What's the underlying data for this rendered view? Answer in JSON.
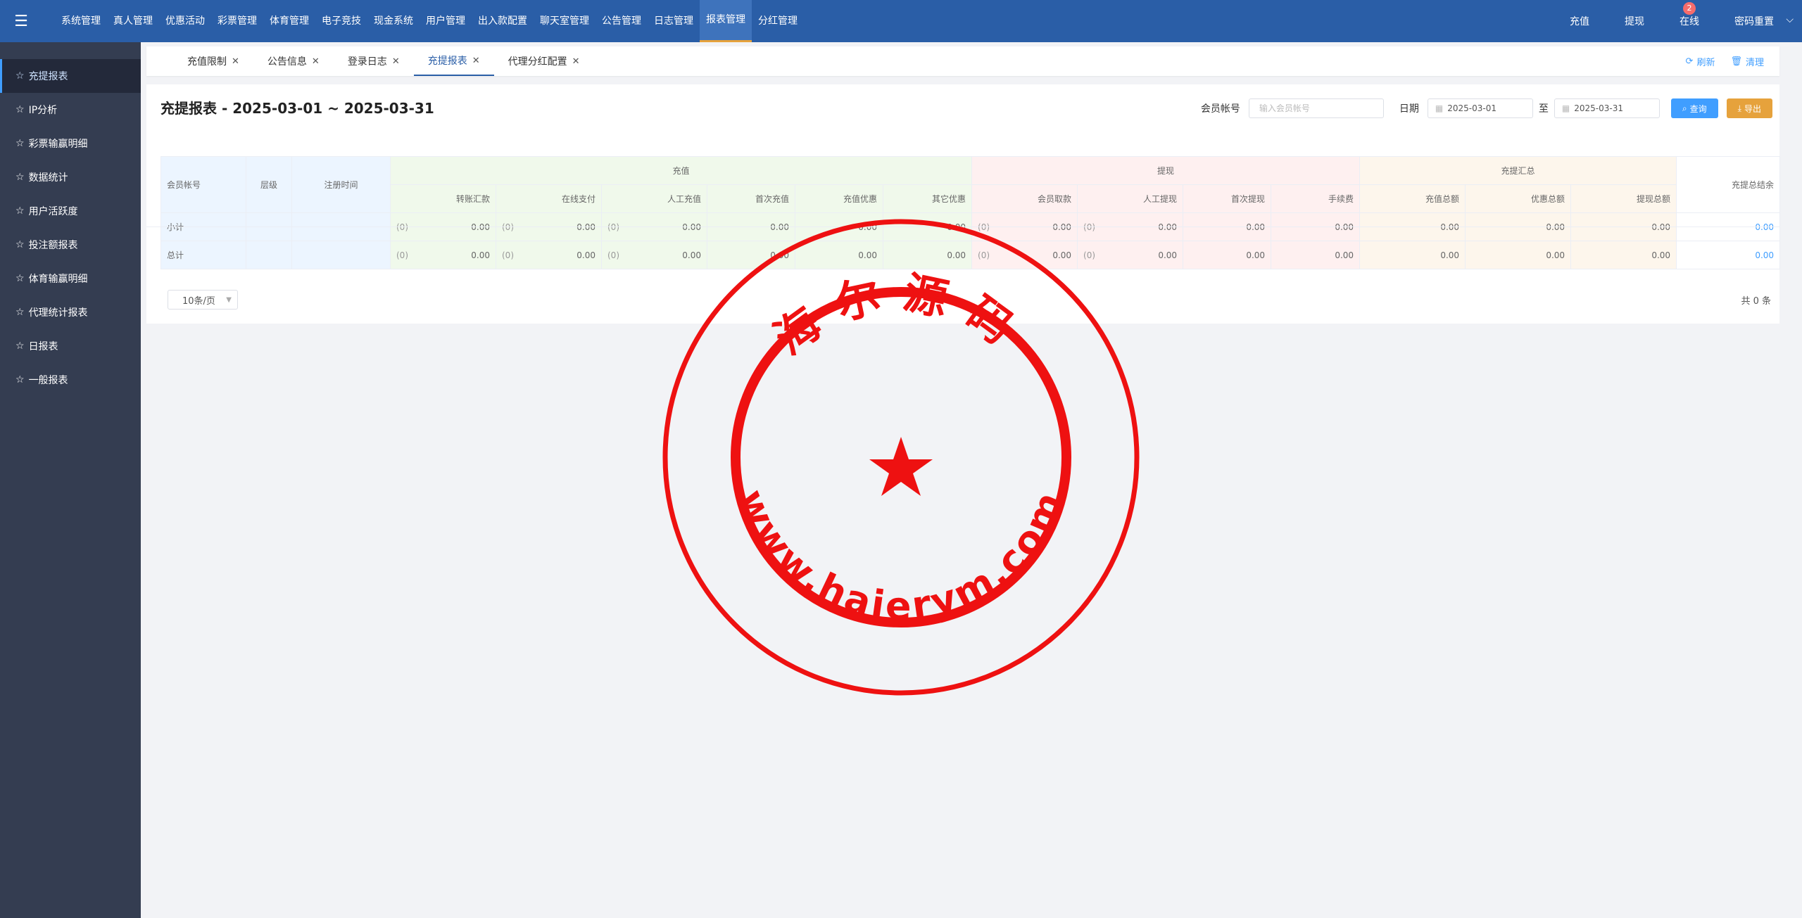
{
  "topnav": {
    "items": [
      "系统管理",
      "真人管理",
      "优惠活动",
      "彩票管理",
      "体育管理",
      "电子竞技",
      "现金系统",
      "用户管理",
      "出入款配置",
      "聊天室管理",
      "公告管理",
      "日志管理",
      "报表管理",
      "分红管理"
    ],
    "active_index": 12,
    "right": {
      "deposit": "充值",
      "withdraw": "提现",
      "online": "在线",
      "online_badge": "2",
      "password_reset": "密码重置"
    }
  },
  "sidebar": {
    "items": [
      "充提报表",
      "IP分析",
      "彩票输赢明细",
      "数据统计",
      "用户活跃度",
      "投注额报表",
      "体育输赢明细",
      "代理统计报表",
      "日报表",
      "一般报表"
    ],
    "active_index": 0
  },
  "tabs": {
    "items": [
      "充值限制",
      "公告信息",
      "登录日志",
      "充提报表",
      "代理分红配置"
    ],
    "active_index": 3,
    "refresh": "刷新",
    "clear": "清理"
  },
  "page": {
    "title": "充提报表 - 2025-03-01 ~ 2025-03-31"
  },
  "filters": {
    "member_label": "会员帐号",
    "member_placeholder": "输入会员帐号",
    "date_label": "日期",
    "date_from": "2025-03-01",
    "to_label": "至",
    "date_to": "2025-03-31",
    "search_label": "查询",
    "export_label": "导出"
  },
  "table": {
    "fixed_headers": [
      "会员帐号",
      "层级",
      "注册时间"
    ],
    "groups": {
      "deposit": "充值",
      "withdraw": "提现",
      "summary": "充提汇总",
      "net": "充提总结余"
    },
    "deposit_cols": [
      "转账汇款",
      "在线支付",
      "人工充值",
      "首次充值",
      "充值优惠",
      "其它优惠"
    ],
    "withdraw_cols": [
      "会员取款",
      "人工提现",
      "首次提现",
      "手续费"
    ],
    "summary_cols": [
      "充值总额",
      "优惠总额",
      "提现总额"
    ],
    "rows": [
      {
        "label": "小计",
        "deposit": [
          {
            "cnt": "(0)",
            "v": "0.00"
          },
          {
            "cnt": "(0)",
            "v": "0.00"
          },
          {
            "cnt": "(0)",
            "v": "0.00"
          },
          {
            "cnt": "",
            "v": "0.00"
          },
          {
            "cnt": "",
            "v": "0.00"
          },
          {
            "cnt": "",
            "v": "0.00"
          }
        ],
        "withdraw": [
          {
            "cnt": "(0)",
            "v": "0.00"
          },
          {
            "cnt": "(0)",
            "v": "0.00"
          },
          {
            "cnt": "",
            "v": "0.00"
          },
          {
            "cnt": "",
            "v": "0.00"
          }
        ],
        "summary": [
          "0.00",
          "0.00",
          "0.00"
        ],
        "net": "0.00"
      },
      {
        "label": "总计",
        "deposit": [
          {
            "cnt": "(0)",
            "v": "0.00"
          },
          {
            "cnt": "(0)",
            "v": "0.00"
          },
          {
            "cnt": "(0)",
            "v": "0.00"
          },
          {
            "cnt": "",
            "v": "0.00"
          },
          {
            "cnt": "",
            "v": "0.00"
          },
          {
            "cnt": "",
            "v": "0.00"
          }
        ],
        "withdraw": [
          {
            "cnt": "(0)",
            "v": "0.00"
          },
          {
            "cnt": "(0)",
            "v": "0.00"
          },
          {
            "cnt": "",
            "v": "0.00"
          },
          {
            "cnt": "",
            "v": "0.00"
          }
        ],
        "summary": [
          "0.00",
          "0.00",
          "0.00"
        ],
        "net": "0.00"
      }
    ]
  },
  "pager": {
    "page_size": "10条/页",
    "total": "共 0 条"
  },
  "stamp": {
    "top_text": "海尔源码",
    "bottom_text": "www.haierym.com",
    "color": "#ee1111"
  }
}
